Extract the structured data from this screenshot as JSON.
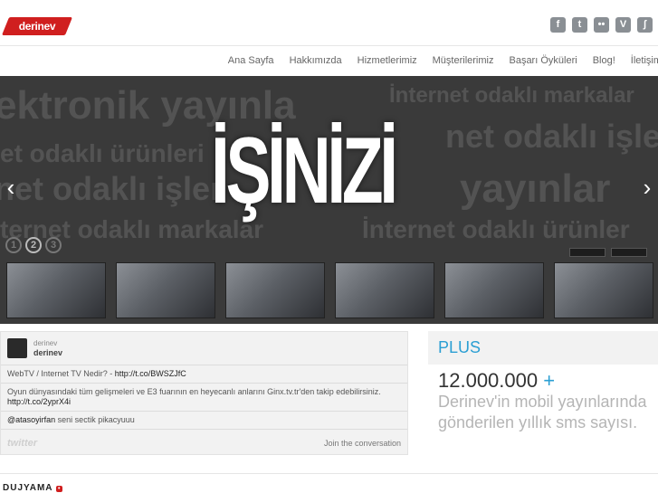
{
  "brand": {
    "logo": "derinev"
  },
  "social": [
    {
      "icon": "facebook-icon",
      "glyph": "f"
    },
    {
      "icon": "twitter-icon",
      "glyph": "t"
    },
    {
      "icon": "flickr-icon",
      "glyph": "••"
    },
    {
      "icon": "vimeo-icon",
      "glyph": "V"
    },
    {
      "icon": "rss-icon",
      "glyph": "ʃ"
    }
  ],
  "nav": [
    "Ana Sayfa",
    "Hakkımızda",
    "Hizmetlerimiz",
    "Müşterilerimiz",
    "Başarı Öyküleri",
    "Blog!",
    "İletişim"
  ],
  "slider": {
    "headline": "İŞİNİZİ",
    "bg_texts": [
      "ektronik yayınla",
      "İnternet odaklı markalar",
      "et odaklı ürünleri",
      "net odaklı işler",
      "net odaklı işle",
      "yayınlar",
      "ternet odaklı markalar",
      "İnternet odaklı ürünler"
    ],
    "prev": "‹",
    "next": "›",
    "pages": [
      "1",
      "2",
      "3"
    ],
    "active_page": 2,
    "thumb_count": 6,
    "brands": [
      "",
      ""
    ]
  },
  "twitter": {
    "user_small": "derinev",
    "user_bold": "derinev",
    "tweets": [
      {
        "text": "WebTV / Internet TV Nedir? - ",
        "link": "http://t.co/BWSZJfC"
      },
      {
        "text": "Oyun dünyasındaki tüm gelişmeleri ve E3 fuarının en heyecanlı anlarını Ginx.tv.tr'den takip edebilirsiniz. ",
        "link": "http://t.co/2yprX4i"
      },
      {
        "text": " seni sectik pikacyuuu",
        "link": "@atasoyirfan"
      }
    ],
    "logo": "twitter",
    "join": "Join the conversation"
  },
  "plus": {
    "title": "PLUS",
    "number": "12.000.000",
    "plus_sign": "+",
    "description": "Derinev'in mobil yayınlarında gönderilen yıllık sms sayısı."
  },
  "footer": {
    "logo": "DUJYAMA",
    "tag": "•"
  }
}
